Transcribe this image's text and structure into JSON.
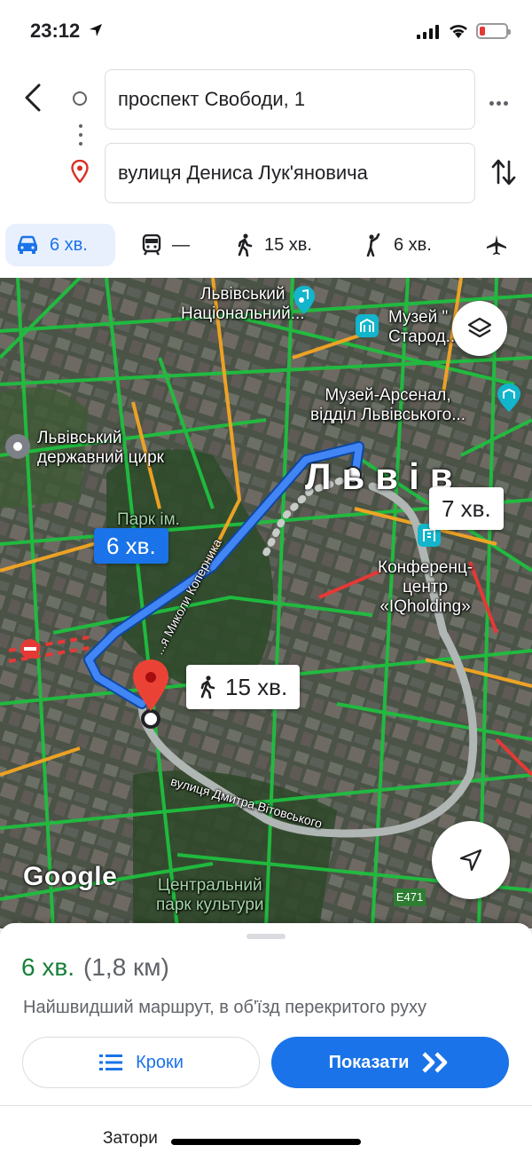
{
  "status_bar": {
    "time": "23:12"
  },
  "route": {
    "origin": "проспект Свободи, 1",
    "destination": "вулиця Дениса Лук'яновича"
  },
  "modes": [
    {
      "name": "drive",
      "label": "6 хв.",
      "selected": true
    },
    {
      "name": "transit",
      "label": "—"
    },
    {
      "name": "walk",
      "label": "15 хв."
    },
    {
      "name": "ride",
      "label": "6 хв."
    },
    {
      "name": "flight",
      "label": ""
    }
  ],
  "map": {
    "labels": {
      "lviv_national": "Львівський\nНаціональний...",
      "museum": "Музей \"\nСтарод...",
      "arsenal": "Музей-Арсенал,\nвідділ Львівського...",
      "circus": "Львівський\nдержавний цирк",
      "park_imeni": "Парк ім.\n...нка",
      "city": "Львів",
      "conference": "Конференц-\nцентр\n«IQholding»",
      "street_kopernyka": "...я Миколи Коперника",
      "street_vitovskogo": "вулиця Дмитра Вітовського",
      "central_park": "Центральний\nпарк культури",
      "highway": "E471"
    },
    "callouts": {
      "drive": "6 хв.",
      "walk": "15 хв.",
      "alt": "7 хв."
    },
    "logo": "Google"
  },
  "sheet": {
    "duration": "6 хв.",
    "distance": "(1,8 км)",
    "description": "Найшвидший маршрут, в об'їзд перекритого руху",
    "steps_label": "Кроки",
    "start_label": "Показати",
    "traffic_tab": "Затори"
  },
  "colors": {
    "accent": "#1a73e8",
    "duration_green": "#188038",
    "route_blue": "#4285f4",
    "traffic_green": "#1fbf3f",
    "traffic_orange": "#f5a623",
    "traffic_red": "#e53935"
  }
}
